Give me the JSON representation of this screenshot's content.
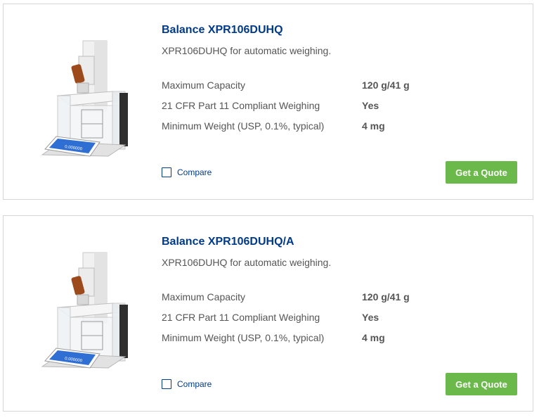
{
  "products": [
    {
      "title": "Balance XPR106DUHQ",
      "subtitle": "XPR106DUHQ for automatic weighing.",
      "specs": [
        {
          "label": "Maximum Capacity",
          "value": "120 g/41 g"
        },
        {
          "label": "21 CFR Part 11 Compliant Weighing",
          "value": "Yes"
        },
        {
          "label": "Minimum Weight (USP, 0.1%, typical)",
          "value": "4 mg"
        }
      ],
      "compare_label": "Compare",
      "quote_label": "Get a Quote",
      "display_reading": "0.000000"
    },
    {
      "title": "Balance XPR106DUHQ/A",
      "subtitle": "XPR106DUHQ for automatic weighing.",
      "specs": [
        {
          "label": "Maximum Capacity",
          "value": "120 g/41 g"
        },
        {
          "label": "21 CFR Part 11 Compliant Weighing",
          "value": "Yes"
        },
        {
          "label": "Minimum Weight (USP, 0.1%, typical)",
          "value": "4 mg"
        }
      ],
      "compare_label": "Compare",
      "quote_label": "Get a Quote",
      "display_reading": "0.000000"
    }
  ],
  "colors": {
    "title": "#003a88",
    "button": "#6ab94a",
    "text": "#555555",
    "border": "#d6d6d6"
  }
}
